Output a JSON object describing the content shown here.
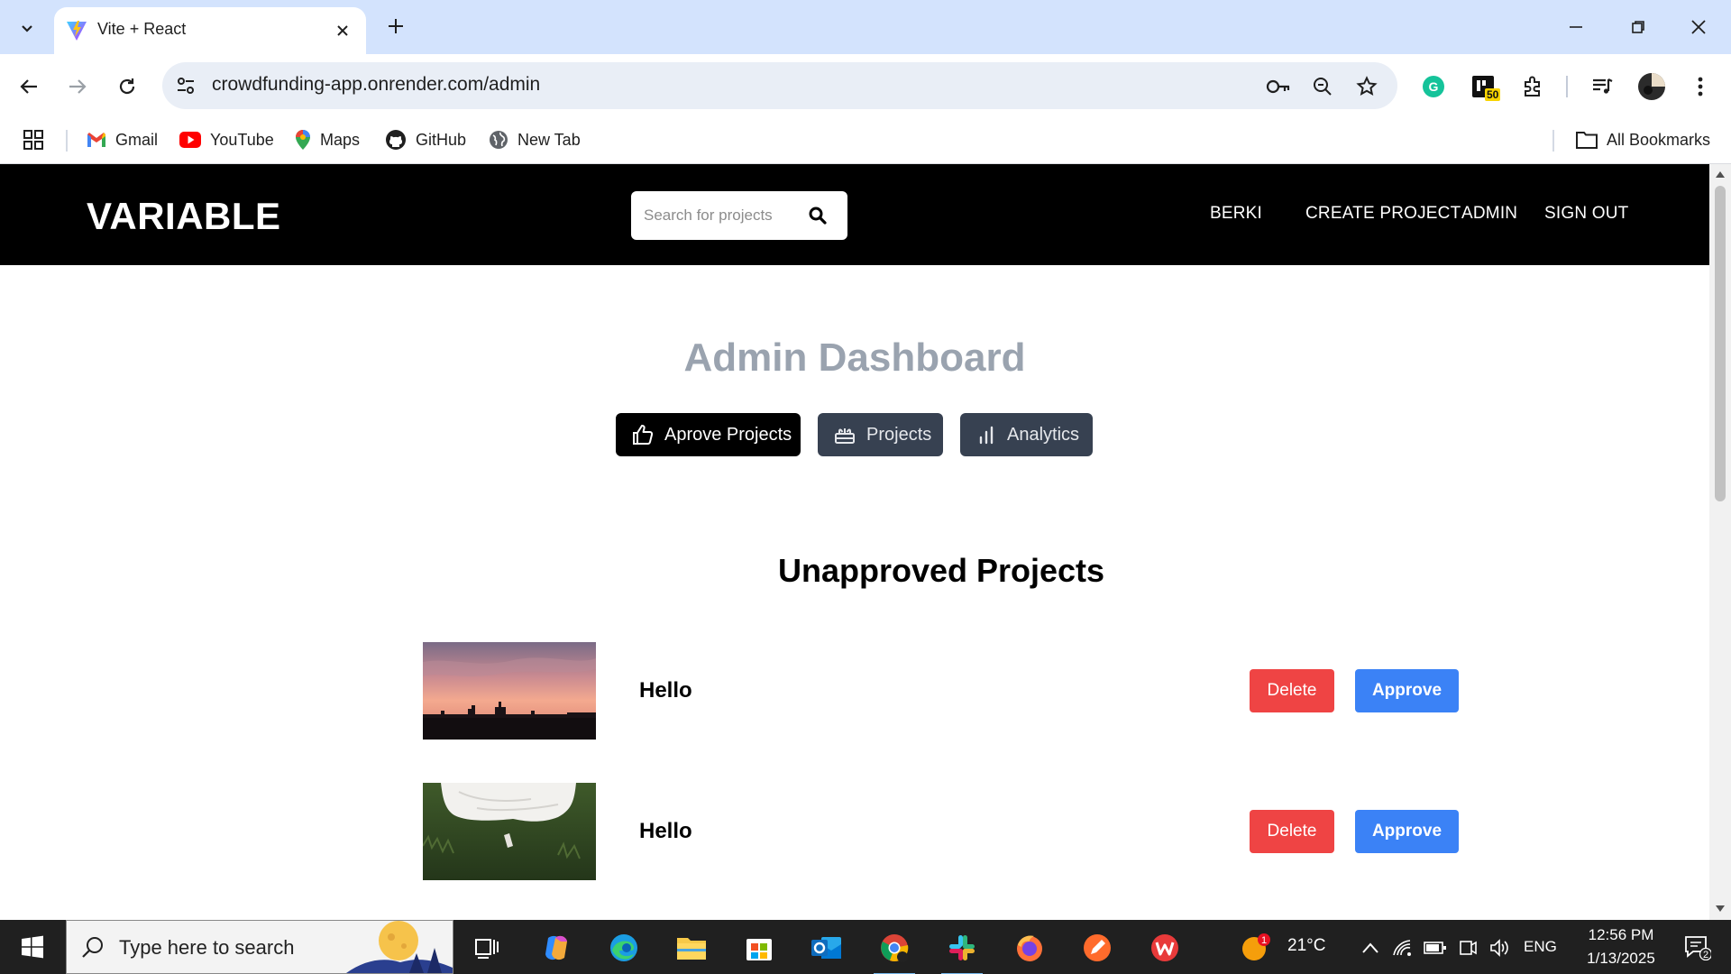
{
  "browser": {
    "tab": {
      "title": "Vite + React"
    },
    "address": {
      "url": "crowdfunding-app.onrender.com/admin"
    },
    "extension_badge": "50",
    "bookmarks": [
      {
        "label": "Gmail"
      },
      {
        "label": "YouTube"
      },
      {
        "label": "Maps"
      },
      {
        "label": "GitHub"
      },
      {
        "label": "New Tab"
      }
    ],
    "all_bookmarks": "All Bookmarks"
  },
  "site": {
    "logo": "VARIABLE",
    "search_placeholder": "Search for projects",
    "nav": {
      "user": "BERKI",
      "create": "CREATE PROJECT",
      "admin": "ADMIN",
      "signout": "SIGN OUT"
    }
  },
  "dashboard": {
    "title": "Admin Dashboard",
    "tabs": [
      {
        "label": "Aprove Projects",
        "active": true
      },
      {
        "label": "Projects",
        "active": false
      },
      {
        "label": "Analytics",
        "active": false
      }
    ],
    "section_title": "Unapproved Projects",
    "projects": [
      {
        "name": "Hello",
        "delete_label": "Delete",
        "approve_label": "Approve"
      },
      {
        "name": "Hello",
        "delete_label": "Delete",
        "approve_label": "Approve"
      }
    ]
  },
  "taskbar": {
    "search_placeholder": "Type here to search",
    "weather": "21°C",
    "weather_badge": "1",
    "language": "ENG",
    "time": "12:56 PM",
    "date": "1/13/2025",
    "notifications": "2"
  },
  "colors": {
    "navbar": "#000000",
    "delete": "#ef4444",
    "approve": "#3b82f6",
    "tab_inactive": "#374151",
    "title_gray": "#9aa3af"
  }
}
